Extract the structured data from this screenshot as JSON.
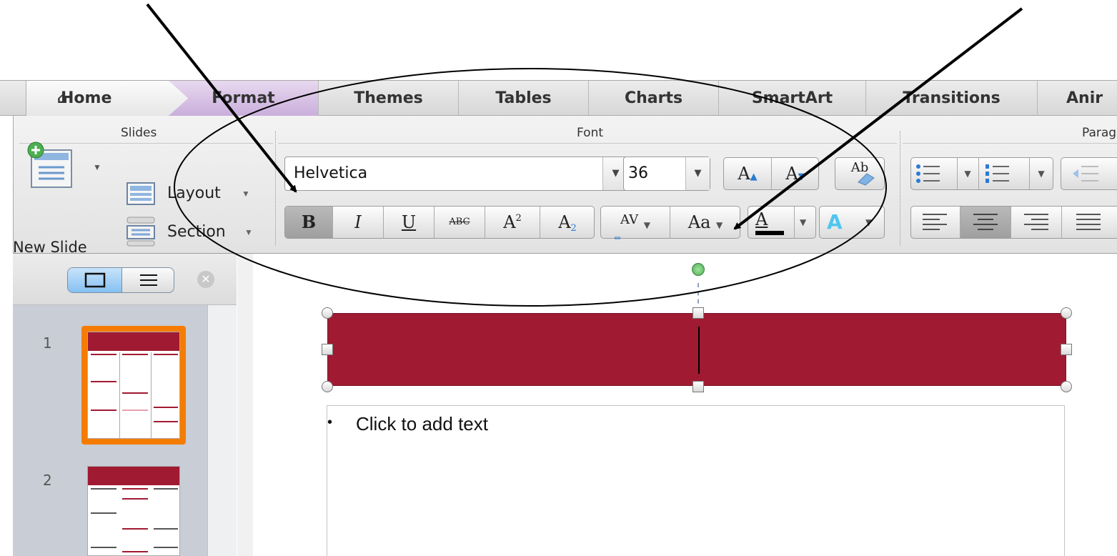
{
  "tabs": {
    "home": "Home",
    "format": "Format",
    "themes": "Themes",
    "tables": "Tables",
    "charts": "Charts",
    "smartart": "SmartArt",
    "transitions": "Transitions",
    "animations_partial": "Anir"
  },
  "ribbon": {
    "slides_group": "Slides",
    "font_group": "Font",
    "paragraph_group_partial": "Parag",
    "new_slide": "New Slide",
    "layout": "Layout",
    "section": "Section",
    "font_name": "Helvetica",
    "font_size": "36",
    "grow_font": "A",
    "shrink_font": "A",
    "clear_format": "Ab",
    "bold": "B",
    "italic": "I",
    "underline": "U",
    "strikethrough": "ABC",
    "superscript_base": "A",
    "superscript_mark": "2",
    "subscript_base": "A",
    "subscript_mark": "2",
    "char_spacing": "AV",
    "change_case": "Aa",
    "font_color": "A",
    "text_effects": "A"
  },
  "panel": {
    "slide_numbers": [
      "1",
      "2"
    ]
  },
  "slide": {
    "body_placeholder": "Click to add text",
    "title_color": "#a01a32"
  },
  "colors": {
    "selected_thumb_border": "#f57c00",
    "format_tab": "#c9aedb"
  }
}
